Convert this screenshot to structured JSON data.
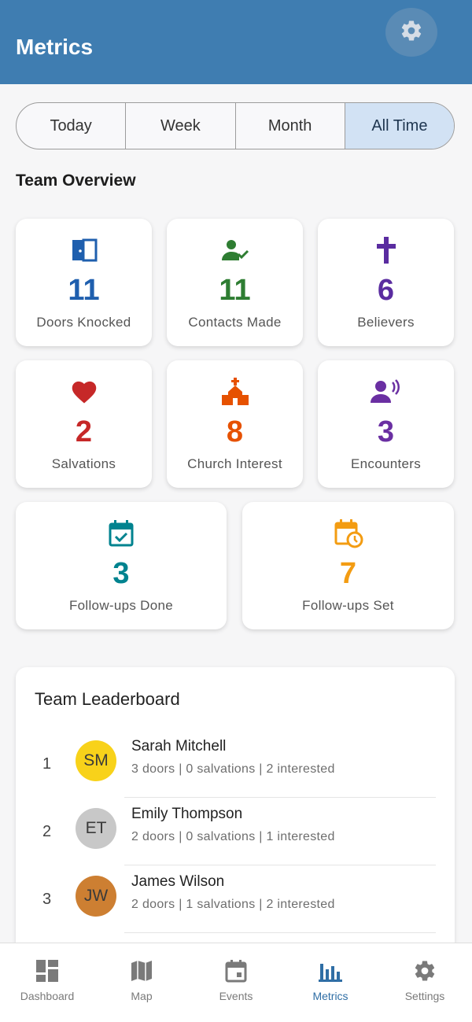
{
  "app": {
    "title": "Metrics"
  },
  "filters": {
    "options": [
      "Today",
      "Week",
      "Month",
      "All Time"
    ],
    "selected": "All Time"
  },
  "overview": {
    "title": "Team Overview",
    "cards": [
      {
        "value": "11",
        "label": "Doors Knocked",
        "icon": "door-icon",
        "color": "#1f5fae"
      },
      {
        "value": "11",
        "label": "Contacts Made",
        "icon": "person-check-icon",
        "color": "#2e7d32"
      },
      {
        "value": "6",
        "label": "Believers",
        "icon": "cross-icon",
        "color": "#5a2ca0"
      },
      {
        "value": "2",
        "label": "Salvations",
        "icon": "heart-icon",
        "color": "#c62828"
      },
      {
        "value": "8",
        "label": "Church Interest",
        "icon": "church-icon",
        "color": "#e65100"
      },
      {
        "value": "3",
        "label": "Encounters",
        "icon": "record-voice-icon",
        "color": "#6a2fa2"
      },
      {
        "value": "3",
        "label": "Follow-ups Done",
        "icon": "event-available-icon",
        "color": "#00838f"
      },
      {
        "value": "7",
        "label": "Follow-ups Set",
        "icon": "event-clock-icon",
        "color": "#f39c12"
      }
    ]
  },
  "leaderboard": {
    "title": "Team Leaderboard",
    "entries": [
      {
        "rank": "1",
        "initials": "SM",
        "name": "Sarah Mitchell",
        "stats": "3 doors | 0 salvations | 2 interested",
        "avatar_color": "#f8d21a"
      },
      {
        "rank": "2",
        "initials": "ET",
        "name": "Emily Thompson",
        "stats": "2 doors | 0 salvations | 1 interested",
        "avatar_color": "#c8c8c8"
      },
      {
        "rank": "3",
        "initials": "JW",
        "name": "James Wilson",
        "stats": "2 doors | 1 salvations | 2 interested",
        "avatar_color": "#cd7f32"
      }
    ]
  },
  "nav": {
    "items": [
      {
        "label": "Dashboard",
        "icon": "dashboard-icon"
      },
      {
        "label": "Map",
        "icon": "map-icon"
      },
      {
        "label": "Events",
        "icon": "calendar-icon"
      },
      {
        "label": "Metrics",
        "icon": "bar-chart-icon"
      },
      {
        "label": "Settings",
        "icon": "gear-icon"
      }
    ],
    "active": "Metrics",
    "active_color": "#2f6ea5"
  }
}
